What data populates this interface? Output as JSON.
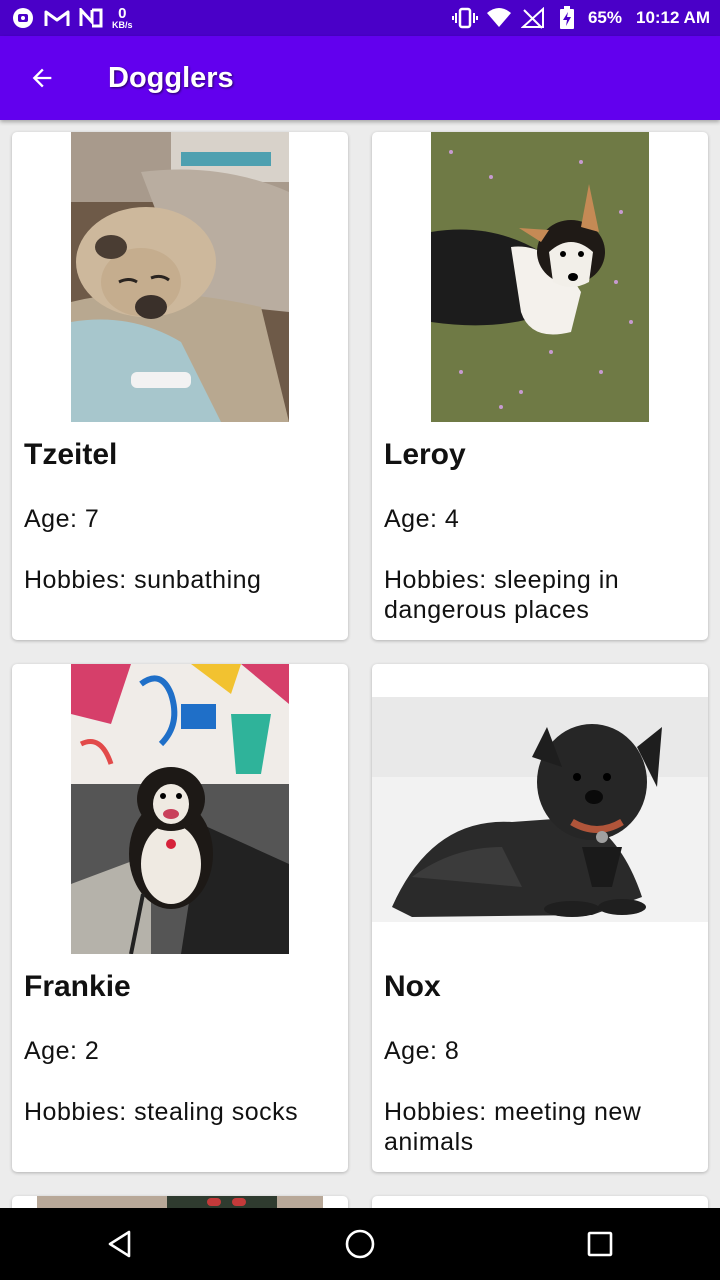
{
  "status_bar": {
    "speed_value": "0",
    "speed_unit": "KB/s",
    "battery": "65%",
    "time": "10:12 AM"
  },
  "app_bar": {
    "title": "Dogglers"
  },
  "dogs": [
    {
      "name": "Tzeitel",
      "age": "Age: 7",
      "hobbies": "Hobbies: sunbathing",
      "photo": "pug-on-couch"
    },
    {
      "name": "Leroy",
      "age": "Age: 4",
      "hobbies": "Hobbies: sleeping in dangerous places",
      "photo": "corgi-on-grass"
    },
    {
      "name": "Frankie",
      "age": "Age: 2",
      "hobbies": "Hobbies: stealing socks",
      "photo": "doodle-by-mural"
    },
    {
      "name": "Nox",
      "age": "Age: 8",
      "hobbies": "Hobbies: meeting new animals",
      "photo": "black-dog-on-bed"
    }
  ],
  "colors": {
    "status_bar": "#4a00c8",
    "app_bar": "#6200ee"
  }
}
